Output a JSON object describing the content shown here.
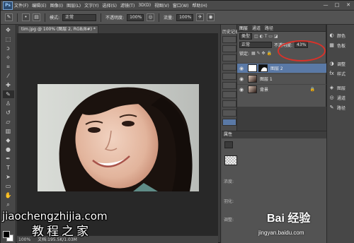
{
  "app": {
    "logo": "Ps",
    "menu": [
      "文件(F)",
      "编辑(E)",
      "图像(I)",
      "图层(L)",
      "文字(Y)",
      "选择(S)",
      "滤镜(T)",
      "3D(D)",
      "视图(V)",
      "窗口(W)",
      "帮助(H)"
    ],
    "window_controls": [
      "—",
      "□",
      "✕"
    ]
  },
  "options_bar": {
    "mode_label": "模式:",
    "mode_value": "正常",
    "opacity_label": "不透明度:",
    "opacity_value": "100%",
    "flow_label": "流量:",
    "flow_value": "100%"
  },
  "document": {
    "tab_title": "tim.jpg @ 100% (图层 2, RGB/8#) *",
    "zoom": "100%",
    "doc_info": "文档:195.5K/1.03M"
  },
  "tools": [
    "move",
    "marquee",
    "lasso",
    "quick-select",
    "crop",
    "eyedropper",
    "healing",
    "brush",
    "stamp",
    "history-brush",
    "eraser",
    "gradient",
    "blur",
    "dodge",
    "pen",
    "type",
    "path-select",
    "shape",
    "hand",
    "zoom"
  ],
  "history_panel": {
    "title": "历史记录"
  },
  "layers_panel": {
    "tabs": [
      "图层",
      "通道",
      "路径"
    ],
    "kind_filter": "类型",
    "blend_mode": "正常",
    "opacity_label": "不透明度:",
    "opacity_value": "43%",
    "lock_label": "锁定:",
    "layers": [
      {
        "name": "图层 2",
        "selected": true,
        "has_mask": true
      },
      {
        "name": "图层 1",
        "selected": false,
        "has_mask": false
      },
      {
        "name": "背景",
        "selected": false,
        "has_mask": false,
        "locked": true
      }
    ]
  },
  "properties_panel": {
    "title": "属性",
    "labels": [
      "浓度:",
      "羽化:",
      "调整:"
    ]
  },
  "dock": {
    "items": [
      "颜色",
      "色板",
      "调整",
      "样式",
      "图层",
      "通道",
      "路径"
    ]
  },
  "watermarks": {
    "site": "jiaochengzhijia.com",
    "site_cn": "教程之家",
    "baidu": "Bai 经验",
    "baidu_url": "jingyan.baidu.com"
  },
  "colors": {
    "highlight": "#d9322a",
    "selection": "#5a79a6"
  }
}
